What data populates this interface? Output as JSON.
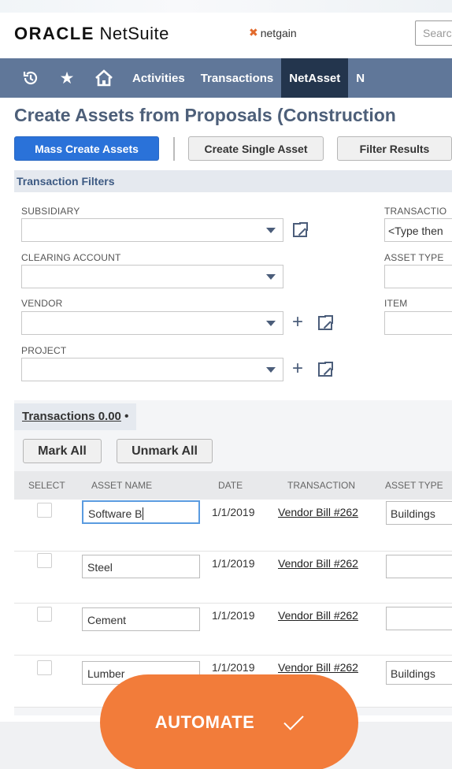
{
  "header": {
    "logo_oracle": "ORACLE",
    "logo_netsuite": "NetSuite",
    "partner_logo": "netgain",
    "search_placeholder": "Search"
  },
  "nav": {
    "icons": [
      "recent-icon",
      "star-icon",
      "home-icon"
    ],
    "items": [
      {
        "label": "Activities",
        "active": false
      },
      {
        "label": "Transactions",
        "active": false
      },
      {
        "label": "NetAsset",
        "active": true
      },
      {
        "label": "N",
        "active": false
      }
    ]
  },
  "page": {
    "title": "Create Assets from Proposals (Construction",
    "buttons": {
      "mass_create": "Mass Create Assets",
      "create_single": "Create Single Asset",
      "filter_results": "Filter Results"
    }
  },
  "filters": {
    "section_title": "Transaction Filters",
    "subsidiary_label": "SUBSIDIARY",
    "subsidiary_value": "",
    "clearing_account_label": "CLEARING ACCOUNT",
    "clearing_account_value": "",
    "vendor_label": "VENDOR",
    "vendor_value": "",
    "project_label": "PROJECT",
    "project_value": "",
    "transaction_label": "TRANSACTIO",
    "transaction_placeholder": "<Type then",
    "asset_type_label": "ASSET TYPE",
    "asset_type_value": "",
    "item_label": "ITEM",
    "item_value": ""
  },
  "transactions": {
    "tab_label": "Transactions 0.00",
    "tab_bullet": "•",
    "mark_all": "Mark All",
    "unmark_all": "Unmark All",
    "columns": [
      "SELECT",
      "ASSET NAME",
      "DATE",
      "TRANSACTION",
      "ASSET TYPE"
    ],
    "rows": [
      {
        "asset_name": "Software B",
        "date": "1/1/2019",
        "transaction": "Vendor Bill #262",
        "asset_type": "Buildings",
        "selected": false
      },
      {
        "asset_name": "Steel",
        "date": "1/1/2019",
        "transaction": "Vendor Bill #262",
        "asset_type": "",
        "selected": false
      },
      {
        "asset_name": "Cement",
        "date": "1/1/2019",
        "transaction": "Vendor Bill #262",
        "asset_type": "",
        "selected": false
      },
      {
        "asset_name": "Lumber",
        "date": "1/1/2019",
        "transaction": "Vendor Bill #262",
        "asset_type": "Buildings",
        "selected": false
      }
    ]
  },
  "automate_button": {
    "label": "AUTOMATE",
    "color": "#f27c3a"
  },
  "colors": {
    "nav_bg": "#607799",
    "nav_active": "#23354d",
    "primary_button": "#2a72d9",
    "title_text": "#4d5f79"
  }
}
